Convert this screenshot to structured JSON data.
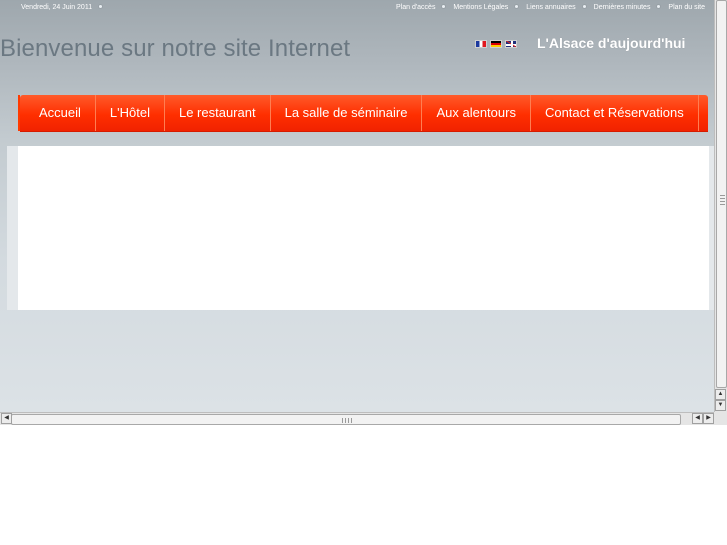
{
  "topbar": {
    "date": "Vendredi, 24 Juin 2011",
    "links": [
      "Plan d'accès",
      "Mentions Légales",
      "Liens annuaires",
      "Dernières minutes",
      "Plan du site"
    ]
  },
  "header": {
    "welcome": "Bienvenue sur notre site Internet",
    "tagline": "L'Alsace d'aujourd'hui",
    "flags": [
      "flag-fr-icon",
      "flag-de-icon",
      "flag-uk-icon"
    ]
  },
  "nav": {
    "items": [
      "Accueil",
      "L'Hôtel",
      "Le restaurant",
      "La salle de séminaire",
      "Aux alentours",
      "Contact et Réservations"
    ]
  },
  "colors": {
    "nav_background": "#ff3300",
    "title_text": "#6b7882",
    "page_background": "#aeb6bc"
  }
}
